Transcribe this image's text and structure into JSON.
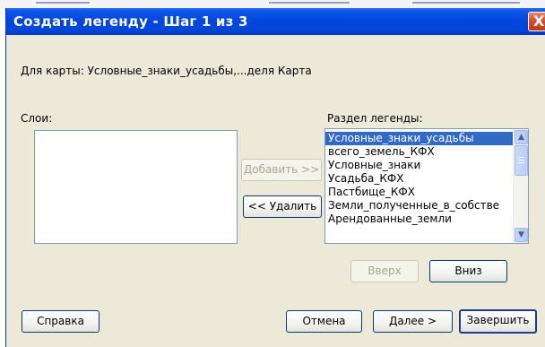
{
  "dialog": {
    "title": "Создать легенду - Шаг 1 из 3",
    "close_glyph": "X"
  },
  "map_caption": "Для карты: Условные_знаки_усадьбы,...деля Карта",
  "layers_panel": {
    "label": "Слои:",
    "items": []
  },
  "legend_panel": {
    "label": "Раздел легенды:",
    "items": [
      "Условные_знаки_усадьбы",
      "всего_земель_КФХ",
      "Условные_знаки",
      "Усадьба_КФХ",
      "Пастбище_КФХ",
      "Земли_полученные_в_собстве",
      "Арендованные_земли"
    ],
    "selected_index": 0
  },
  "buttons": {
    "add": "Добавить >>",
    "remove": "<< Удалить",
    "up": "Вверх",
    "down": "Вниз",
    "help": "Справка",
    "cancel": "Отмена",
    "next": "Далее >",
    "finish": "Завершить"
  },
  "icons": {
    "scroll_up": "▲",
    "scroll_down": "▼"
  },
  "colors": {
    "title_bar": "#0345da",
    "selection": "#316ac5",
    "dialog_bg": "#ece9d8",
    "close_button": "#d4502e"
  }
}
